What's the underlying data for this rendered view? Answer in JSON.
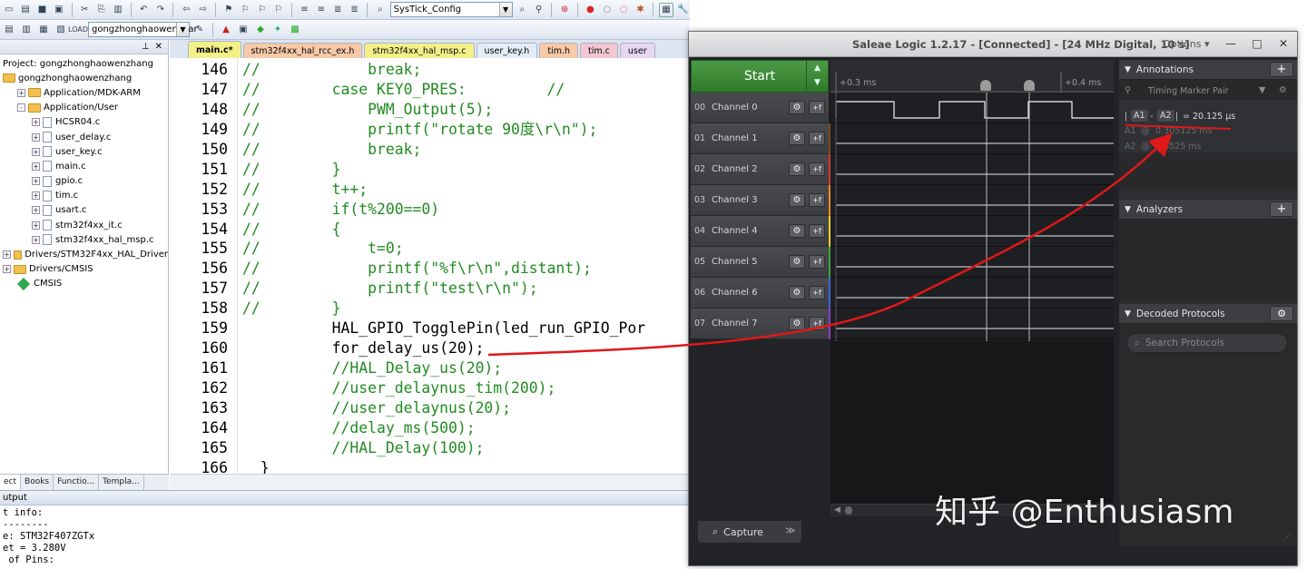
{
  "ide": {
    "toolbar": {
      "function_combo": "SysTick_Config",
      "target_combo": "gongzhonghaowenzhar"
    },
    "project": {
      "title": "Project: gongzhonghaowenzhang",
      "items": [
        {
          "label": "gongzhonghaowenzhang",
          "depth": 0,
          "type": "root"
        },
        {
          "label": "Application/MDK-ARM",
          "depth": 1,
          "type": "folder",
          "exp": "+"
        },
        {
          "label": "Application/User",
          "depth": 1,
          "type": "folder",
          "exp": "-"
        },
        {
          "label": "HCSR04.c",
          "depth": 2,
          "type": "file",
          "exp": "+"
        },
        {
          "label": "user_delay.c",
          "depth": 2,
          "type": "file",
          "exp": "+"
        },
        {
          "label": "user_key.c",
          "depth": 2,
          "type": "file",
          "exp": "+"
        },
        {
          "label": "main.c",
          "depth": 2,
          "type": "file",
          "exp": "+"
        },
        {
          "label": "gpio.c",
          "depth": 2,
          "type": "file",
          "exp": "+"
        },
        {
          "label": "tim.c",
          "depth": 2,
          "type": "file",
          "exp": "+"
        },
        {
          "label": "usart.c",
          "depth": 2,
          "type": "file",
          "exp": "+"
        },
        {
          "label": "stm32f4xx_it.c",
          "depth": 2,
          "type": "file",
          "exp": "+"
        },
        {
          "label": "stm32f4xx_hal_msp.c",
          "depth": 2,
          "type": "file",
          "exp": "+"
        },
        {
          "label": "Drivers/STM32F4xx_HAL_Driver",
          "depth": 0,
          "type": "folder",
          "exp": "+"
        },
        {
          "label": "Drivers/CMSIS",
          "depth": 0,
          "type": "folder",
          "exp": "+"
        },
        {
          "label": "CMSIS",
          "depth": 1,
          "type": "gem"
        }
      ],
      "bottom_tabs": [
        "ect",
        "Books",
        "Functio...",
        "Templa..."
      ]
    },
    "editor_tabs": [
      {
        "label": "main.c*",
        "color": "#f3f08a",
        "active": true
      },
      {
        "label": "stm32f4xx_hal_rcc_ex.h",
        "color": "#f7c9a8",
        "active": false
      },
      {
        "label": "stm32f4xx_hal_msp.c",
        "color": "#f3f08a",
        "active": false
      },
      {
        "label": "user_key.h",
        "color": "#e4ecf7",
        "active": false
      },
      {
        "label": "tim.h",
        "color": "#f7c9a8",
        "active": false
      },
      {
        "label": "tim.c",
        "color": "#f2c7d2",
        "active": false
      },
      {
        "label": "user",
        "color": "#e6d6f2",
        "active": false
      }
    ],
    "code_lines": [
      {
        "n": "146",
        "t": "//            break;",
        "c": true
      },
      {
        "n": "147",
        "t": "//        case KEY0_PRES:         //",
        "c": true
      },
      {
        "n": "148",
        "t": "//            PWM_Output(5);",
        "c": true
      },
      {
        "n": "149",
        "t": "//            printf(\"rotate 90度\\r\\n\");",
        "c": true
      },
      {
        "n": "150",
        "t": "//            break;",
        "c": true
      },
      {
        "n": "151",
        "t": "//        }",
        "c": true
      },
      {
        "n": "152",
        "t": "//        t++;",
        "c": true
      },
      {
        "n": "153",
        "t": "//        if(t%200==0)",
        "c": true
      },
      {
        "n": "154",
        "t": "//        {",
        "c": true
      },
      {
        "n": "155",
        "t": "//            t=0;",
        "c": true
      },
      {
        "n": "156",
        "t": "//            printf(\"%f\\r\\n\",distant);",
        "c": true
      },
      {
        "n": "157",
        "t": "//            printf(\"test\\r\\n\");",
        "c": true
      },
      {
        "n": "158",
        "t": "//        }",
        "c": true
      },
      {
        "n": "159",
        "t": "          HAL_GPIO_TogglePin(led_run_GPIO_Por",
        "c": false
      },
      {
        "n": "160",
        "t": "          for_delay_us(20);",
        "c": false
      },
      {
        "n": "161",
        "t": "          //HAL_Delay_us(20);",
        "c": true
      },
      {
        "n": "162",
        "t": "          //user_delaynus_tim(200);",
        "c": true
      },
      {
        "n": "163",
        "t": "          //user_delaynus(20);",
        "c": true
      },
      {
        "n": "164",
        "t": "          //delay_ms(500);",
        "c": true
      },
      {
        "n": "165",
        "t": "          //HAL_Delay(100);",
        "c": true
      },
      {
        "n": "166",
        "t": "  }",
        "c": false
      }
    ],
    "output": {
      "title": "utput",
      "lines": [
        "t info:",
        "--------",
        "e: STM32F407ZGTx",
        "et = 3.280V",
        " of Pins:"
      ]
    }
  },
  "saleae": {
    "title": "Saleae Logic 1.2.17 - [Connected] - [24 MHz Digital, 10 s]",
    "options_label": "Options ▾",
    "start_label": "Start",
    "time_labels": [
      "+0.3 ms",
      "+0.4 ms"
    ],
    "channels": [
      {
        "num": "00",
        "name": "Channel 0",
        "color": "#1a1a1a"
      },
      {
        "num": "01",
        "name": "Channel 1",
        "color": "#7a4a22"
      },
      {
        "num": "02",
        "name": "Channel 2",
        "color": "#d33a2c"
      },
      {
        "num": "03",
        "name": "Channel 3",
        "color": "#f08a24"
      },
      {
        "num": "04",
        "name": "Channel 4",
        "color": "#f1d02c"
      },
      {
        "num": "05",
        "name": "Channel 5",
        "color": "#3aa33b"
      },
      {
        "num": "06",
        "name": "Channel 6",
        "color": "#3d63d8"
      },
      {
        "num": "07",
        "name": "Channel 7",
        "color": "#8a3fc4"
      }
    ],
    "capture_label": "Capture",
    "annotations": {
      "header": "Annotations",
      "marker_pair": "Timing Marker Pair",
      "delta_a1": "A1",
      "delta_a2": "A2",
      "delta_value": "= 20.125 µs",
      "a1_label": "A1",
      "a1_value": "0.305125 ms",
      "a2_label": "A2",
      "a2_value": "0.8525 ms"
    },
    "analyzers_header": "Analyzers",
    "decoded_header": "Decoded Protocols",
    "search_placeholder": "Search Protocols"
  },
  "watermark": "知乎 @Enthusiasm",
  "colors": {
    "arrow": "#e0181a",
    "comment_green": "#228b22"
  }
}
